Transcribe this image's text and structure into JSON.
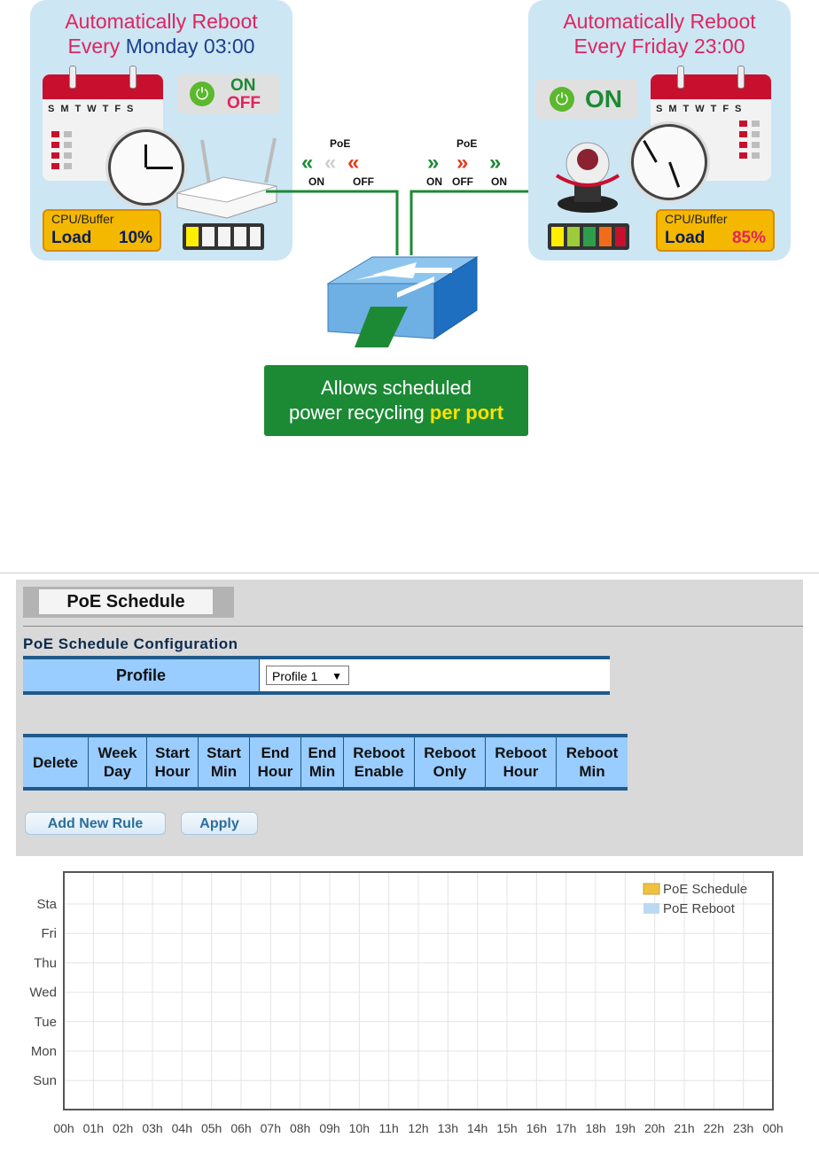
{
  "illustration": {
    "left": {
      "title_line1": "Automatically Reboot",
      "title_pre": "Every ",
      "title_day": "Monday",
      "title_time": " 03:00",
      "cal_days": "SMTWTFS",
      "on": "ON",
      "off": "OFF",
      "cpu_label": "CPU/Buffer",
      "load_label": "Load",
      "load_value": "10%"
    },
    "right": {
      "title_line1": "Automatically Reboot",
      "title_line2": "Every Friday 23:00",
      "cal_days": "SMTWTFS",
      "on": "ON",
      "cpu_label": "CPU/Buffer",
      "load_label": "Load",
      "load_value": "85%"
    },
    "poe_left": {
      "label": "PoE",
      "on": "ON",
      "off": "OFF"
    },
    "poe_right": {
      "label": "PoE",
      "on1": "ON",
      "off": "OFF",
      "on2": "ON"
    },
    "callout_line1": "Allows scheduled",
    "callout_line2_pre": "power recycling ",
    "callout_line2_hl": "per port",
    "colors": {
      "panel": "#cce6f4",
      "title_red": "#e0245e",
      "title_blue": "#1b3f8f",
      "callout_green": "#1c8a35",
      "highlight_yellow": "#ffe100"
    }
  },
  "ui": {
    "tab_title": "PoE Schedule",
    "section_title": "PoE Schedule Configuration",
    "profile_label": "Profile",
    "profile_value": "Profile 1",
    "columns": [
      "Delete",
      "Week\nDay",
      "Start\nHour",
      "Start\nMin",
      "End\nHour",
      "End\nMin",
      "Reboot\nEnable",
      "Reboot\nOnly",
      "Reboot\nHour",
      "Reboot\nMin"
    ],
    "buttons": {
      "add": "Add New Rule",
      "apply": "Apply"
    },
    "colors": {
      "header_bg": "#99ccff",
      "header_border": "#1f5a8c",
      "button_text": "#2a6f9b"
    }
  },
  "chart_data": {
    "type": "heatmap",
    "y_categories": [
      "Sta",
      "Fri",
      "Thu",
      "Wed",
      "Tue",
      "Mon",
      "Sun"
    ],
    "x_categories": [
      "00h",
      "01h",
      "02h",
      "03h",
      "04h",
      "05h",
      "06h",
      "07h",
      "08h",
      "09h",
      "10h",
      "11h",
      "12h",
      "13h",
      "14h",
      "15h",
      "16h",
      "17h",
      "18h",
      "19h",
      "20h",
      "21h",
      "22h",
      "23h",
      "00h"
    ],
    "series": [
      {
        "name": "PoE Schedule",
        "color": "#f0c040",
        "values": []
      },
      {
        "name": "PoE Reboot",
        "color": "#bcd9f2",
        "values": []
      }
    ],
    "grid": true,
    "legend": "top-right"
  }
}
